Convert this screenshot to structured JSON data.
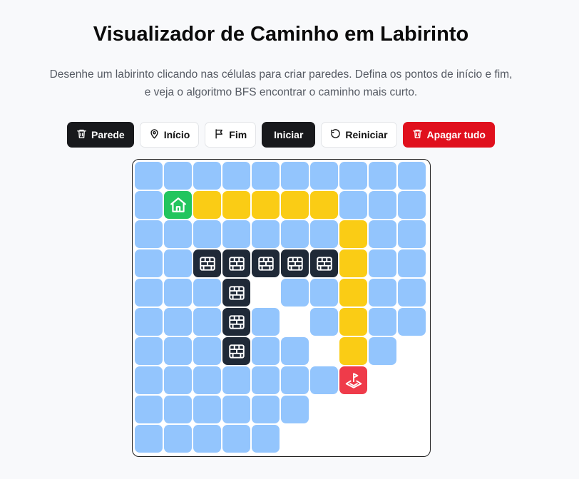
{
  "header": {
    "title": "Visualizador de Caminho em Labirinto",
    "description_line1": "Desenhe um labirinto clicando nas células para criar paredes. Defina os pontos de início e fim,",
    "description_line2": "e veja o algoritmo BFS encontrar o caminho mais curto."
  },
  "toolbar": {
    "wall_label": "Parede",
    "start_label": "Início",
    "end_label": "Fim",
    "run_label": "Iniciar",
    "reset_label": "Reiniciar",
    "clear_label": "Apagar tudo",
    "active_tool": "Parede"
  },
  "maze": {
    "rows": 10,
    "cols": 10,
    "legend": {
      "v": "visited",
      "e": "empty",
      "p": "path",
      "w": "wall",
      "s": "start",
      "f": "end"
    },
    "grid": [
      "vvvvvvvvvv",
      "vspppppvvv",
      "vvvvvvvpvv",
      "vvwwwwwpvv",
      "vvvwevvpvv",
      "vvvwvevpvv",
      "vvvwvvepve",
      "vvvvvvvfee",
      "vvvvvveeee",
      "vvvvveeeee"
    ]
  },
  "colors": {
    "visited": "#93c5fd",
    "path": "#facc15",
    "wall": "#1f2937",
    "start": "#22c55e",
    "end": "#ef3b4a",
    "empty": "#ffffff",
    "danger": "#e0101d"
  },
  "icons": {
    "wall": "brick-wall-icon",
    "start": "home-icon",
    "end": "flag-pin-icon"
  }
}
